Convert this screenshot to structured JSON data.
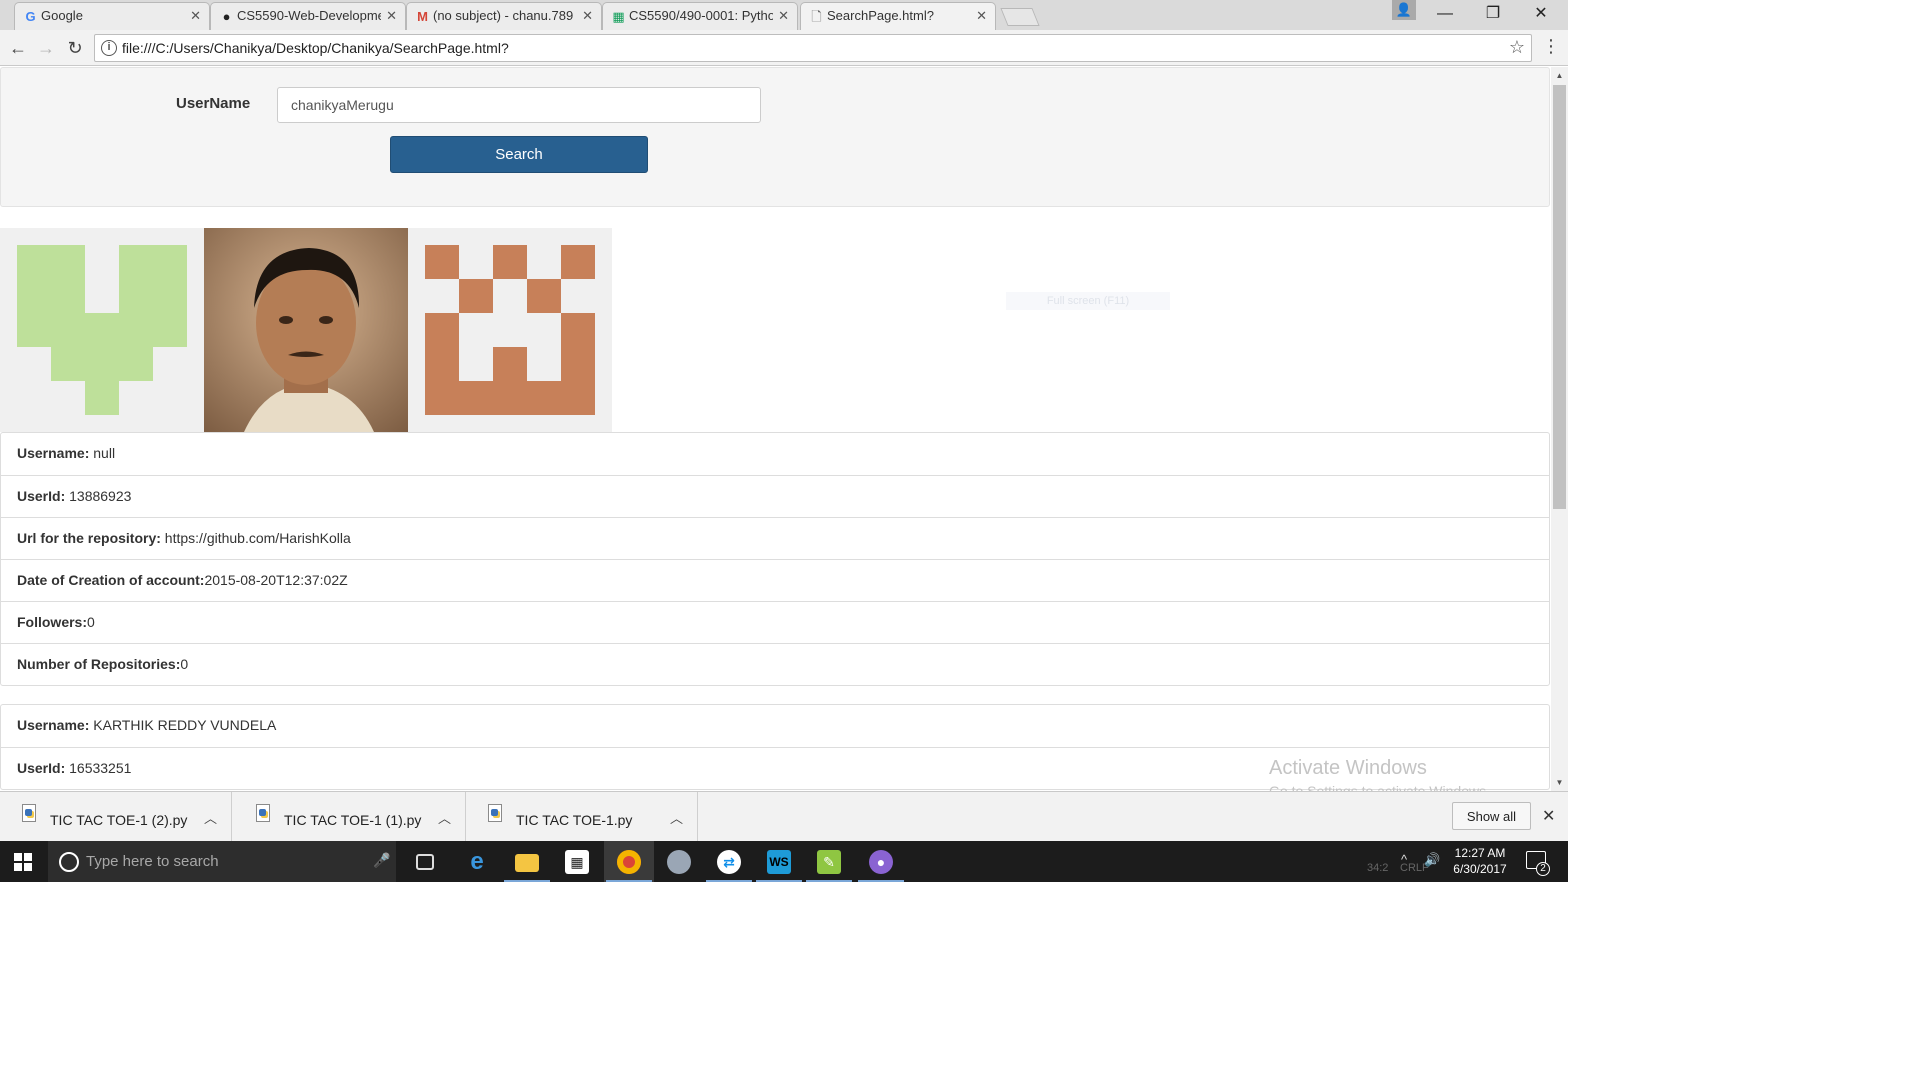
{
  "browser": {
    "tabs": [
      {
        "title": "Google",
        "favicon": "google-icon"
      },
      {
        "title": "CS5590-Web-Developme",
        "favicon": "github-icon"
      },
      {
        "title": "(no subject) - chanu.789",
        "favicon": "gmail-icon"
      },
      {
        "title": "CS5590/490-0001: Pytho",
        "favicon": "sheets-icon"
      },
      {
        "title": "SearchPage.html?",
        "favicon": "page-icon",
        "active": true
      }
    ],
    "url": "file:///C:/Users/Chanikya/Desktop/Chanikya/SearchPage.html?"
  },
  "search": {
    "label": "UserName",
    "value": "chanikyaMerugu",
    "button": "Search",
    "button_color": "#286090"
  },
  "avatars": [
    {
      "name": "identicon-green",
      "color": "#bee09a"
    },
    {
      "name": "profile-photo"
    },
    {
      "name": "identicon-orange",
      "color": "#c78059"
    }
  ],
  "ghost_tooltip": "Full screen (F11)",
  "results": [
    {
      "username_label": "Username:",
      "username": "null",
      "userid_label": "UserId:",
      "userid": "13886923",
      "url_label": "Url for the repository:",
      "url": "https://github.com/HarishKolla",
      "created_label": "Date of Creation of account:",
      "created": "2015-08-20T12:37:02Z",
      "followers_label": "Followers:",
      "followers": "0",
      "repos_label": "Number of Repositories:",
      "repos": "0"
    },
    {
      "username_label": "Username:",
      "username": "KARTHIK REDDY VUNDELA",
      "userid_label": "UserId:",
      "userid": "16533251"
    }
  ],
  "watermark": {
    "line1": "Activate Windows",
    "line2": "Go to Settings to activate Windows."
  },
  "downloads": [
    {
      "name": "TIC TAC TOE-1 (2).py"
    },
    {
      "name": "TIC TAC TOE-1 (1).py"
    },
    {
      "name": "TIC TAC TOE-1.py"
    }
  ],
  "show_all": "Show all",
  "taskbar": {
    "search_placeholder": "Type here to search",
    "apps": [
      "task-view-icon",
      "edge-icon",
      "file-explorer-icon",
      "store-icon",
      "chrome-icon",
      "paint-icon",
      "teamviewer-icon",
      "webstorm-icon",
      "notepadpp-icon",
      "github-desktop-icon"
    ],
    "time": "12:27 AM",
    "date": "6/30/2017",
    "notifications": "2",
    "status_pos": "34:2",
    "status_eol": "CRLF"
  }
}
